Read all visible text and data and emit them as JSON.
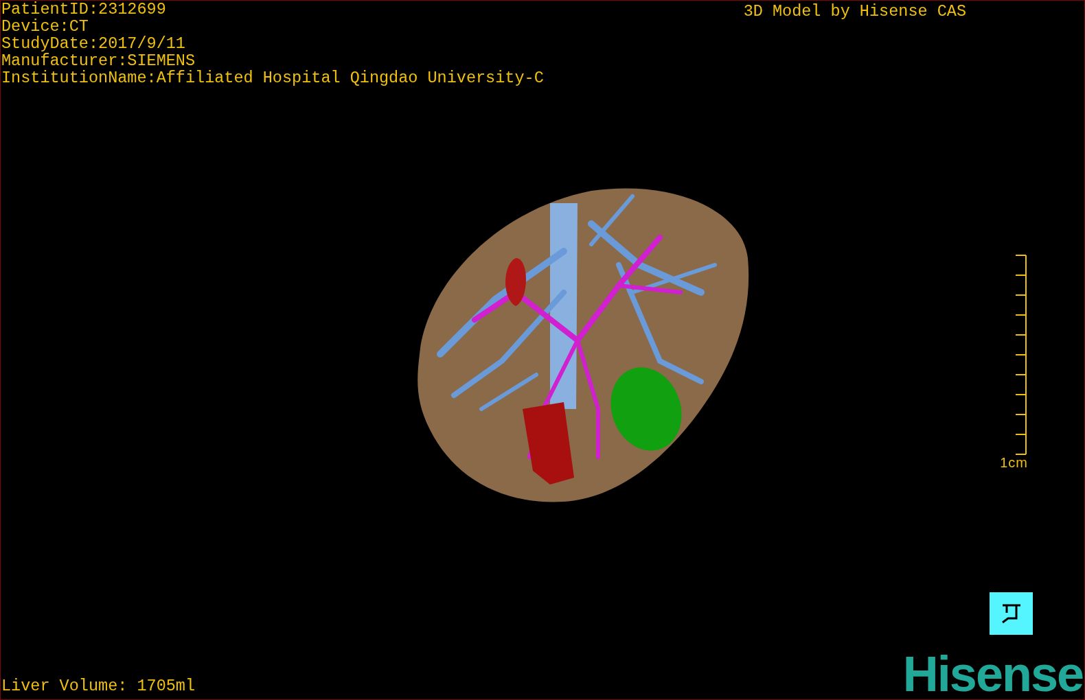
{
  "study_info": [
    "PatientID:2312699",
    "Device:CT",
    "StudyDate:2017/9/11",
    "Manufacturer:SIEMENS",
    "InstitutionName:Affiliated Hospital Qingdao University-C"
  ],
  "title": "3D Model by Hisense CAS",
  "scale_bar": {
    "label": "1cm"
  },
  "liver_volume": "Liver Volume: 1705ml",
  "logo": "Hisense"
}
